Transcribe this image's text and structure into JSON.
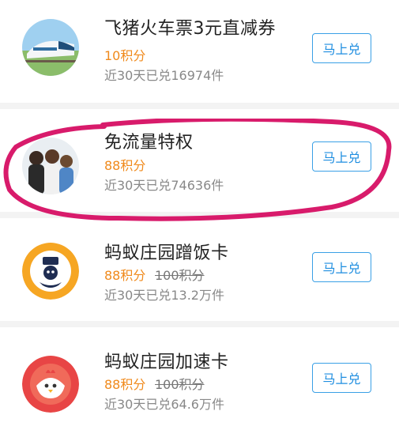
{
  "items": [
    {
      "title": "飞猪火车票3元直减券",
      "price": "10积分",
      "original_price": "",
      "sold": "近30天已兑16974件",
      "button": "马上兑",
      "icon": "train-icon"
    },
    {
      "title": "免流量特权",
      "price": "88积分",
      "original_price": "",
      "sold": "近30天已兑74636件",
      "button": "马上兑",
      "icon": "people-photo-icon"
    },
    {
      "title": "蚂蚁庄园蹭饭卡",
      "price": "88积分",
      "original_price": "100积分",
      "sold": "近30天已兑13.2万件",
      "button": "马上兑",
      "icon": "chicken-food-card-icon"
    },
    {
      "title": "蚂蚁庄园加速卡",
      "price": "88积分",
      "original_price": "100积分",
      "sold": "近30天已兑64.6万件",
      "button": "马上兑",
      "icon": "chicken-speed-card-icon"
    }
  ],
  "colors": {
    "price": "#f08a1c",
    "button_border": "#3aa0e6",
    "highlight_circle": "#d81b6b"
  }
}
